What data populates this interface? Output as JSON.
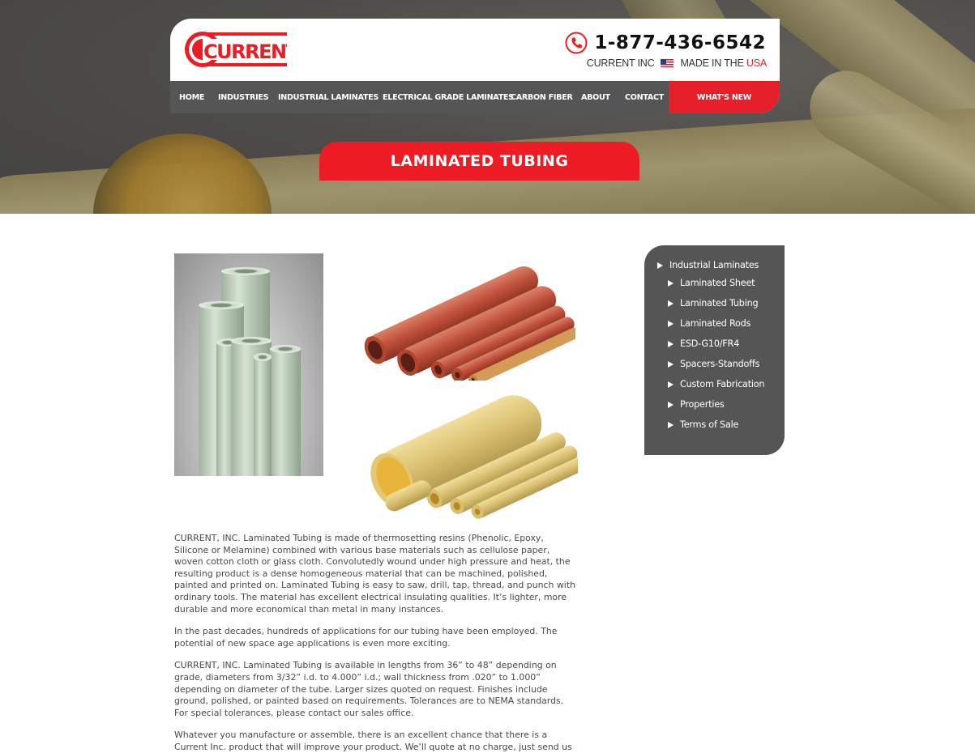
{
  "header": {
    "logo_text": "CURRENT",
    "phone": "1-877-436-6542",
    "company": "CURRENT INC",
    "made_in": "MADE IN THE",
    "made_in_country": "USA",
    "icons": {
      "phone": "phone-icon",
      "flag": "us-flag-icon"
    }
  },
  "nav": {
    "items": [
      {
        "label": "HOME"
      },
      {
        "label": "INDUSTRIES"
      },
      {
        "label": "INDUSTRIAL LAMINATES"
      },
      {
        "label": "ELECTRICAL GRADE LAMINATES"
      },
      {
        "label": "CARBON FIBER"
      },
      {
        "label": "ABOUT"
      },
      {
        "label": "CONTACT"
      }
    ],
    "highlight": "WHAT'S NEW"
  },
  "page": {
    "title": "LAMINATED TUBING"
  },
  "content": {
    "paragraphs": [
      "CURRENT, INC. Laminated Tubing is made of thermosetting resins (Phenolic, Epoxy, Silicone or Melamine) combined with various base materials such as cellulose paper, woven cotton cloth or glass cloth. Convolutedly wound under high pressure and heat, the resulting product is a dense homogeneous material that can be machined, polished, painted and printed on. Laminated Tubing is easy to saw, drill, tap, thread, and punch with ordinary tools. The material has excellent electrical insulating qualities. It’s lighter, more durable and more economical than metal in many instances.",
      "In the past decades, hundreds of applications for our tubing have been employed. The potential of new space age applications is even more exciting.",
      "CURRENT, INC. Laminated Tubing is available in lengths from 36” to 48” depending on grade, diameters from 3/32” i.d. to 4.000” i.d.; wall thickness from .020” to 1.000” depending on diameter of the tube. Larger sizes quoted on request. Finishes include ground, polished, or painted based on requirements. Tolerances are to NEMA standards. For special tolerances, please contact our sales office.",
      "Whatever you manufacture or assemble, there is an excellent chance that there is a Current Inc. product that will improve your product. We’ll quote at no charge, just send us your specs and/or blue prints."
    ]
  },
  "sidebar": {
    "main": "Industrial Laminates",
    "items": [
      {
        "label": "Laminated Sheet"
      },
      {
        "label": "Laminated Tubing"
      },
      {
        "label": "Laminated Rods"
      },
      {
        "label": "ESD-G10/FR4"
      },
      {
        "label": "Spacers-Standoffs"
      },
      {
        "label": "Custom Fabrication"
      },
      {
        "label": "Properties"
      },
      {
        "label": "Terms of Sale"
      }
    ]
  },
  "colors": {
    "brand_red": "#ec1c24",
    "nav_gray": "#555556"
  }
}
